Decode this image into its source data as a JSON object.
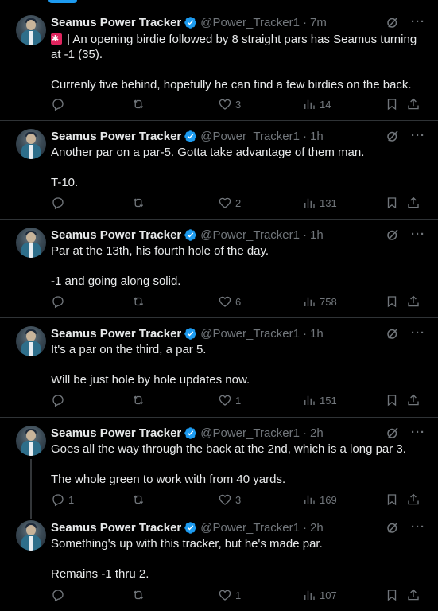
{
  "account": {
    "name": "Seamus Power Tracker",
    "handle": "@Power_Tracker1"
  },
  "colors": {
    "accent": "#1d9bf0",
    "muted": "#71767b",
    "text": "#e7e9ea",
    "alarm": "#e0245e"
  },
  "icons": [
    "verified-badge-icon",
    "grok-icon",
    "more-icon",
    "reply-icon",
    "retweet-icon",
    "like-icon",
    "views-icon",
    "bookmark-icon",
    "share-icon",
    "siren-emoji"
  ],
  "tweets": [
    {
      "time": "7m",
      "text_lead": "| An opening birdie followed by 8 straight pars has Seamus turning at -1 (35).",
      "text": "Currenly five behind, hopefully he can find a few birdies on the back.",
      "replies": "",
      "likes": "3",
      "views": "14"
    },
    {
      "time": "1h",
      "text": "Another par on a par-5. Gotta take advantage of them man.\n\nT-10.",
      "replies": "",
      "likes": "2",
      "views": "131"
    },
    {
      "time": "1h",
      "text": "Par at the 13th, his fourth hole of the day.\n\n-1 and going along solid.",
      "replies": "",
      "likes": "6",
      "views": "758"
    },
    {
      "time": "1h",
      "text": "It's a par on the third, a par 5.\n\nWill be just hole by hole updates now.",
      "replies": "",
      "likes": "1",
      "views": "151"
    },
    {
      "time": "2h",
      "text": "Goes all the way through the back at the 2nd, which is a long par 3.\n\nThe whole green to work with from 40 yards.",
      "replies": "1",
      "likes": "3",
      "views": "169"
    },
    {
      "time": "2h",
      "text": "Something's up with this tracker, but he's made par.\n\nRemains -1 thru 2.",
      "replies": "",
      "likes": "1",
      "views": "107"
    }
  ]
}
